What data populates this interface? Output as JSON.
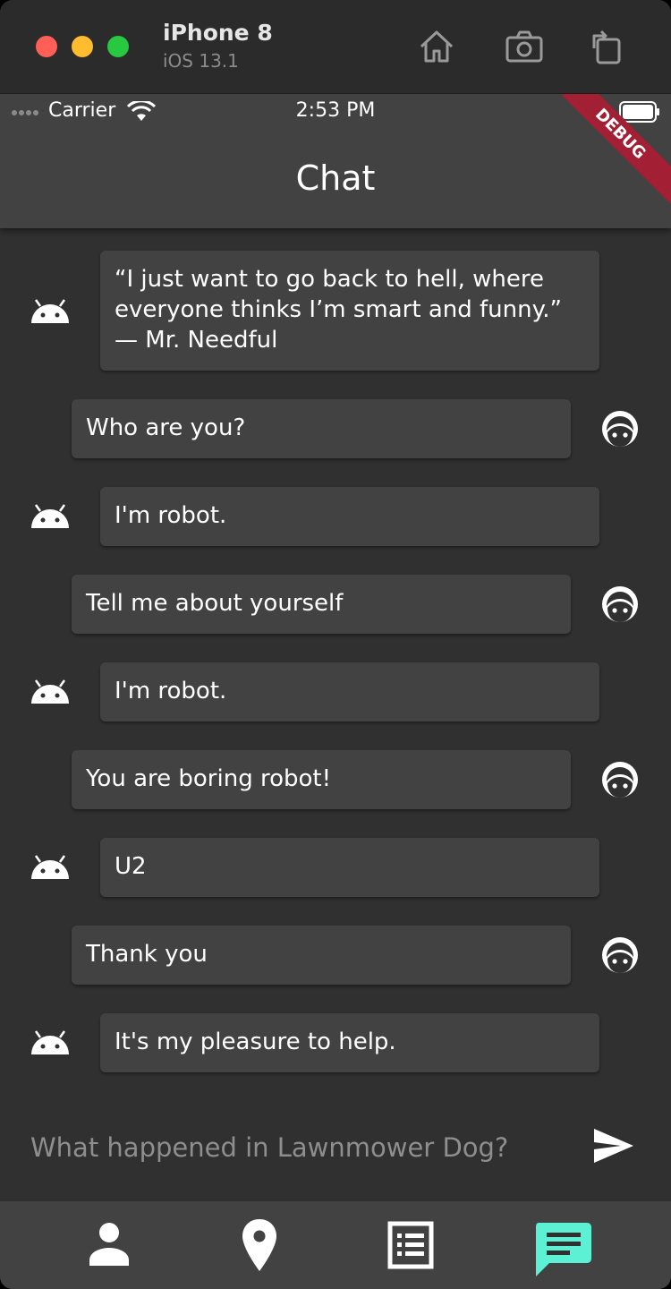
{
  "simulator": {
    "device_name": "iPhone 8",
    "os_version": "iOS 13.1",
    "icons": [
      "home-icon",
      "screenshot-icon",
      "rotate-icon"
    ]
  },
  "status_bar": {
    "carrier": "Carrier",
    "time": "2:53 PM"
  },
  "debug_banner": "DEBUG",
  "app_bar": {
    "title": "Chat"
  },
  "messages": [
    {
      "sender": "bot",
      "text": "“I just want to go back to hell, where everyone thinks I’m smart and funny.” — Mr. Needful"
    },
    {
      "sender": "user",
      "text": "Who are you?"
    },
    {
      "sender": "bot",
      "text": "I'm robot."
    },
    {
      "sender": "user",
      "text": "Tell me about yourself"
    },
    {
      "sender": "bot",
      "text": "I'm robot."
    },
    {
      "sender": "user",
      "text": "You are boring robot!"
    },
    {
      "sender": "bot",
      "text": "U2"
    },
    {
      "sender": "user",
      "text": "Thank you"
    },
    {
      "sender": "bot",
      "text": "It's my pleasure to help."
    }
  ],
  "composer": {
    "placeholder": "What happened in Lawnmower Dog?"
  },
  "bottom_nav": {
    "items": [
      "person-icon",
      "location-pin-icon",
      "list-icon",
      "chat-icon"
    ],
    "active": "chat-icon"
  },
  "colors": {
    "background": "#303030",
    "surface": "#424242",
    "accent": "#5cf0d4",
    "debug_banner": "#a31f34"
  }
}
